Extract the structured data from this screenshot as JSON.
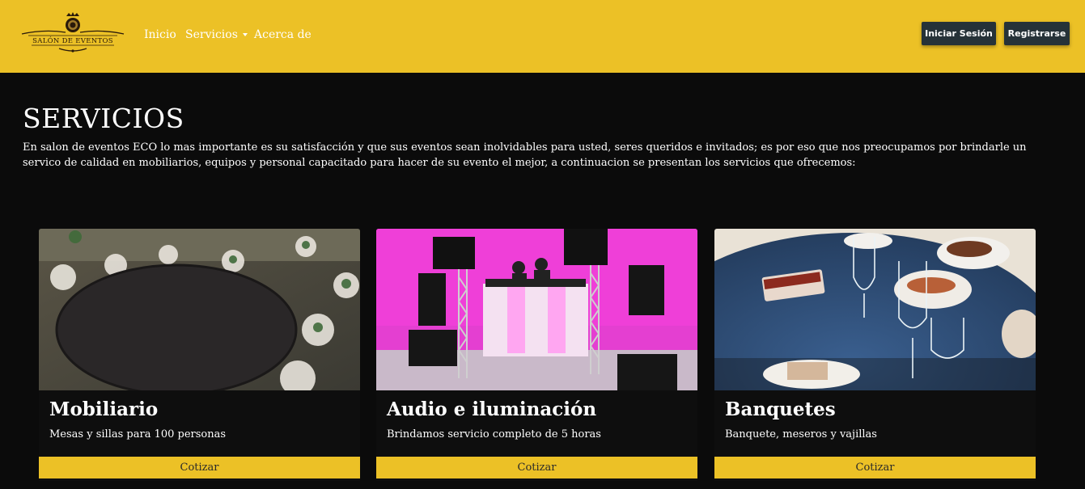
{
  "brand": {
    "logo_alt": "SALÓN DE EVENTOS",
    "icon": "crest-logo-icon"
  },
  "nav": {
    "links": [
      {
        "label": "Inicio"
      },
      {
        "label": "Servicios",
        "icon": "caret-down-icon"
      },
      {
        "label": "Acerca de"
      }
    ],
    "login_label": "Iniciar Sesión",
    "register_label": "Registrarse"
  },
  "section": {
    "title": "SERVICIOS",
    "description": "En salon de eventos ECO lo mas importante es su satisfacción y que sus eventos sean inolvidables para usted, seres queridos e invitados; es por eso que nos preocupamos por brindarle un servico de calidad en mobiliarios, equipos y personal capacitado para hacer de su evento el mejor, a continuacion se presentan los servicios que ofrecemos:"
  },
  "cards": [
    {
      "title": "Mobiliario",
      "text": "Mesas y sillas para 100 personas",
      "button": "Cotizar",
      "image": "banquet-hall-photo"
    },
    {
      "title": "Audio e iluminación",
      "text": "Brindamos servicio completo de 5 horas",
      "button": "Cotizar",
      "image": "dj-booth-photo"
    },
    {
      "title": "Banquetes",
      "text": "Banquete, meseros y vajillas",
      "button": "Cotizar",
      "image": "table-setting-photo"
    }
  ],
  "colors": {
    "accent": "#ecc126",
    "background": "#0b0b0b",
    "button_dark": "#263238"
  }
}
